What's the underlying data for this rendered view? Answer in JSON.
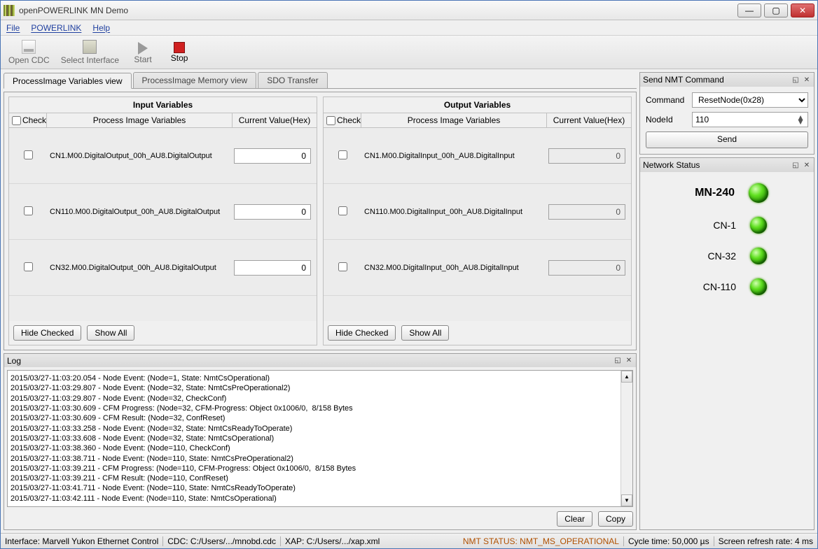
{
  "window": {
    "title": "openPOWERLINK MN Demo"
  },
  "menu": {
    "file": "File",
    "powerlink": "POWERLINK",
    "help": "Help"
  },
  "toolbar": {
    "open_cdc": "Open CDC",
    "select_interface": "Select Interface",
    "start": "Start",
    "stop": "Stop"
  },
  "tabs": {
    "vars": "ProcessImage Variables view",
    "mem": "ProcessImage Memory view",
    "sdo": "SDO Transfer"
  },
  "vars": {
    "input_title": "Input Variables",
    "output_title": "Output Variables",
    "check_label": "Check",
    "name_label": "Process Image Variables",
    "value_label": "Current Value(Hex)",
    "hide_checked": "Hide Checked",
    "show_all": "Show All",
    "inputs": [
      {
        "name": "CN1.M00.DigitalOutput_00h_AU8.DigitalOutput",
        "value": "0"
      },
      {
        "name": "CN110.M00.DigitalOutput_00h_AU8.DigitalOutput",
        "value": "0"
      },
      {
        "name": "CN32.M00.DigitalOutput_00h_AU8.DigitalOutput",
        "value": "0"
      }
    ],
    "outputs": [
      {
        "name": "CN1.M00.DigitalInput_00h_AU8.DigitalInput",
        "value": "0"
      },
      {
        "name": "CN110.M00.DigitalInput_00h_AU8.DigitalInput",
        "value": "0"
      },
      {
        "name": "CN32.M00.DigitalInput_00h_AU8.DigitalInput",
        "value": "0"
      }
    ]
  },
  "nmt": {
    "title": "Send NMT Command",
    "command_label": "Command",
    "command_value": "ResetNode(0x28)",
    "nodeid_label": "NodeId",
    "nodeid_value": "110",
    "send": "Send"
  },
  "network": {
    "title": "Network Status",
    "mn": "MN-240",
    "nodes": [
      "CN-1",
      "CN-32",
      "CN-110"
    ]
  },
  "log": {
    "title": "Log",
    "clear": "Clear",
    "copy": "Copy",
    "lines": [
      "2015/03/27-11:03:20.054 - Node Event: (Node=1, State: NmtCsOperational)",
      "2015/03/27-11:03:29.807 - Node Event: (Node=32, State: NmtCsPreOperational2)",
      "2015/03/27-11:03:29.807 - Node Event: (Node=32, CheckConf)",
      "2015/03/27-11:03:30.609 - CFM Progress: (Node=32, CFM-Progress: Object 0x1006/0,  8/158 Bytes",
      "2015/03/27-11:03:30.609 - CFM Result: (Node=32, ConfReset)",
      "2015/03/27-11:03:33.258 - Node Event: (Node=32, State: NmtCsReadyToOperate)",
      "2015/03/27-11:03:33.608 - Node Event: (Node=32, State: NmtCsOperational)",
      "2015/03/27-11:03:38.360 - Node Event: (Node=110, CheckConf)",
      "2015/03/27-11:03:38.711 - Node Event: (Node=110, State: NmtCsPreOperational2)",
      "2015/03/27-11:03:39.211 - CFM Progress: (Node=110, CFM-Progress: Object 0x1006/0,  8/158 Bytes",
      "2015/03/27-11:03:39.211 - CFM Result: (Node=110, ConfReset)",
      "2015/03/27-11:03:41.711 - Node Event: (Node=110, State: NmtCsReadyToOperate)",
      "2015/03/27-11:03:42.111 - Node Event: (Node=110, State: NmtCsOperational)"
    ]
  },
  "status": {
    "interface": "Interface: Marvell Yukon Ethernet Control",
    "cdc": "CDC: C:/Users/.../mnobd.cdc",
    "xap": "XAP: C:/Users/.../xap.xml",
    "nmt": "NMT STATUS: NMT_MS_OPERATIONAL",
    "cycle": "Cycle time: 50,000 µs",
    "refresh": "Screen refresh rate: 4 ms"
  }
}
